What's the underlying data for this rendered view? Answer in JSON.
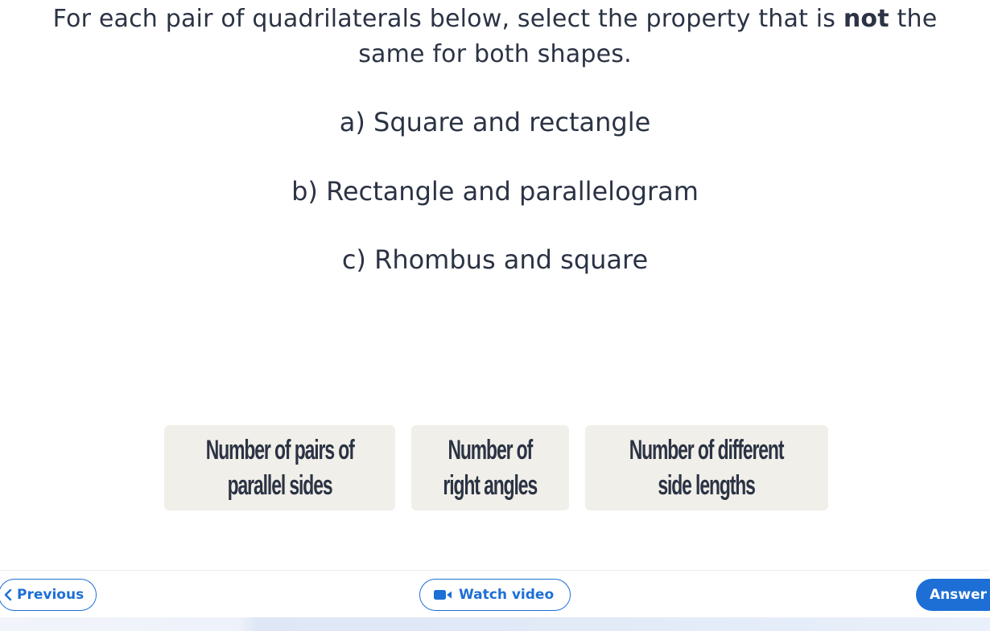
{
  "question": {
    "prompt_before": "For each pair of quadrilaterals below, select the property that is ",
    "prompt_bold": "not",
    "prompt_after": " the same for both shapes.",
    "parts": [
      "a) Square and rectangle",
      "b) Rectangle and parallelogram",
      "c) Rhombus and square"
    ]
  },
  "options": [
    {
      "line1": "Number of pairs of",
      "line2": "parallel sides"
    },
    {
      "line1": "Number of",
      "line2": "right angles"
    },
    {
      "line1": "Number of different",
      "line2": "side lengths"
    }
  ],
  "footer": {
    "previous_label": "Previous",
    "video_label": "Watch video",
    "answer_label": "Answer"
  },
  "colors": {
    "accent": "#1d6fd6",
    "text": "#2b3344",
    "option_bg": "#f1efe9"
  },
  "icons": {
    "previous": "chevron-left-icon",
    "video": "video-camera-icon"
  }
}
